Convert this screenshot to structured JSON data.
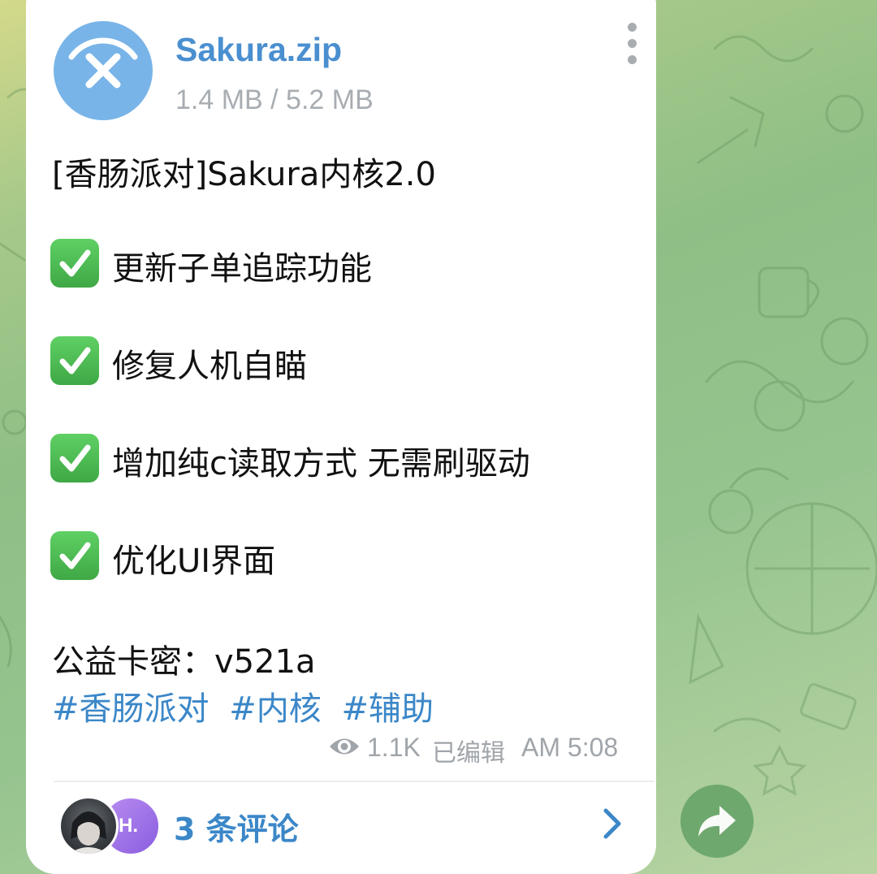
{
  "file": {
    "name": "Sakura.zip",
    "size_progress": "1.4 MB / 5.2 MB",
    "icon": "cancel-download-icon",
    "accent_color": "#78b4e8"
  },
  "message": {
    "title": "[香肠派对]Sakura内核2.0",
    "features": [
      {
        "icon": "check-mark-icon",
        "text": "更新子单追踪功能"
      },
      {
        "icon": "check-mark-icon",
        "text": "修复人机自瞄"
      },
      {
        "icon": "check-mark-icon",
        "text": "增加纯c读取方式 无需刷驱动"
      },
      {
        "icon": "check-mark-icon",
        "text": "优化UI界面"
      }
    ],
    "key_line": "公益卡密：v521a",
    "hashtags": [
      "#香肠派对",
      "#内核",
      "#辅助"
    ]
  },
  "meta": {
    "views": "1.1K",
    "edited_label": "已编辑",
    "time": "AM 5:08"
  },
  "comments": {
    "label": "3 条评论",
    "avatar2_initials": "H."
  },
  "colors": {
    "link": "#3b87c8",
    "check": "#4cbb52",
    "share_button": "#6aa56a"
  }
}
